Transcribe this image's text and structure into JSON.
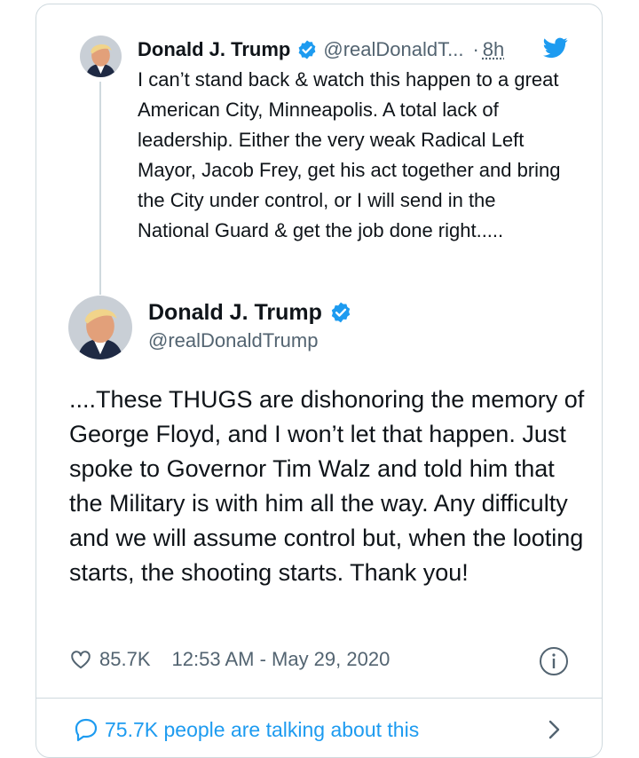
{
  "reply": {
    "name": "Donald J. Trump",
    "handle": "@realDonaldT...",
    "separator": "·",
    "time": "8h",
    "text": "I can’t stand back & watch this happen to a great American City, Minneapolis. A total lack of leadership. Either the very weak Radical Left Mayor, Jacob Frey, get his act together and bring the City under control, or I will send in the National Guard & get the job done right....."
  },
  "tweet": {
    "name": "Donald J. Trump",
    "handle": "@realDonaldTrump",
    "text": "....These THUGS are dishonoring the memory of George Floyd, and I won’t let that happen. Just spoke to Governor Tim Walz and told him that the Military is with him all the way. Any difficulty and we will assume control but, when the looting starts, the shooting starts. Thank you!",
    "likes": "85.7K",
    "timestamp": "12:53 AM - May 29, 2020"
  },
  "footer": {
    "talking": "75.7K people are talking about this"
  },
  "icons": {
    "verified": "verified-badge-icon",
    "twitter": "twitter-bird-icon",
    "like": "heart-icon",
    "info": "info-icon",
    "comment": "speech-bubble-icon",
    "next": "chevron-right-icon"
  },
  "colors": {
    "accent": "#1d9bf0",
    "text": "#0f1419",
    "muted": "#536471",
    "border": "#cfd9de"
  }
}
